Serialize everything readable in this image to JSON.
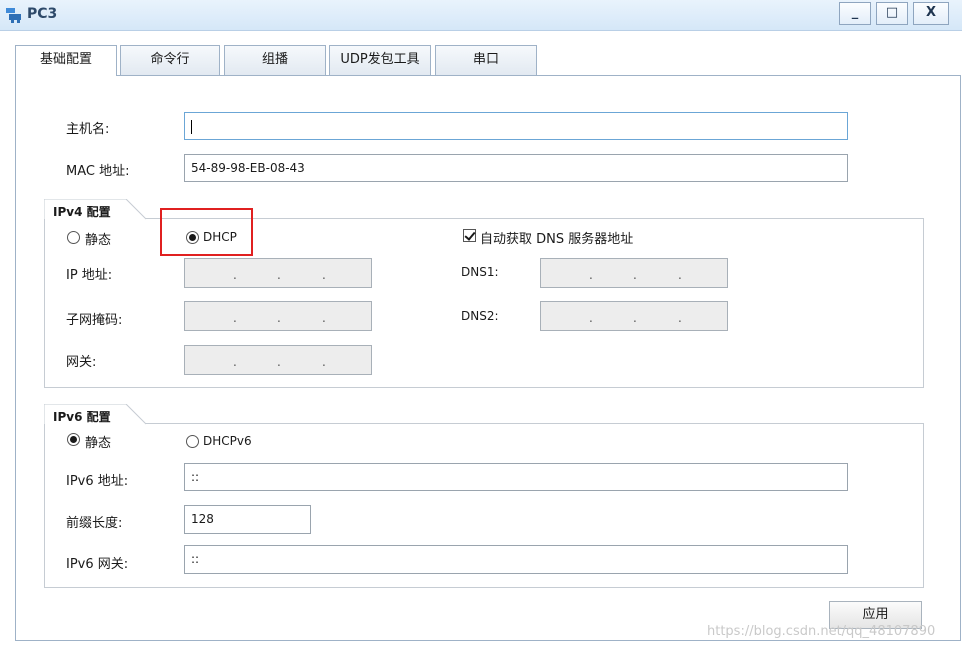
{
  "window": {
    "title": "PC3",
    "minimize_glyph": "_",
    "maximize_glyph": "□",
    "close_glyph": "X"
  },
  "tabs": [
    {
      "label": "基础配置",
      "active": true
    },
    {
      "label": "命令行"
    },
    {
      "label": "组播"
    },
    {
      "label": "UDP发包工具"
    },
    {
      "label": "串口"
    }
  ],
  "basic": {
    "hostname_label": "主机名:",
    "hostname_value": "",
    "mac_label": "MAC 地址:",
    "mac_value": "54-89-98-EB-08-43"
  },
  "ipv4": {
    "group_title": "IPv4 配置",
    "static_label": "静态",
    "dhcp_label": "DHCP",
    "selected": "DHCP",
    "auto_dns_label": "自动获取 DNS 服务器地址",
    "auto_dns_checked": true,
    "ip_label": "IP 地址:",
    "mask_label": "子网掩码:",
    "gateway_label": "网关:",
    "dns1_label": "DNS1:",
    "dns2_label": "DNS2:",
    "ip_dots": ".",
    "highlight_color": "#e02020"
  },
  "ipv6": {
    "group_title": "IPv6 配置",
    "static_label": "静态",
    "dhcpv6_label": "DHCPv6",
    "selected": "静态",
    "addr_label": "IPv6 地址:",
    "addr_value": "::",
    "prefix_label": "前缀长度:",
    "prefix_value": "128",
    "gateway_label": "IPv6 网关:",
    "gateway_value": "::"
  },
  "apply_label": "应用",
  "watermark": "https://blog.csdn.net/qq_48107890"
}
